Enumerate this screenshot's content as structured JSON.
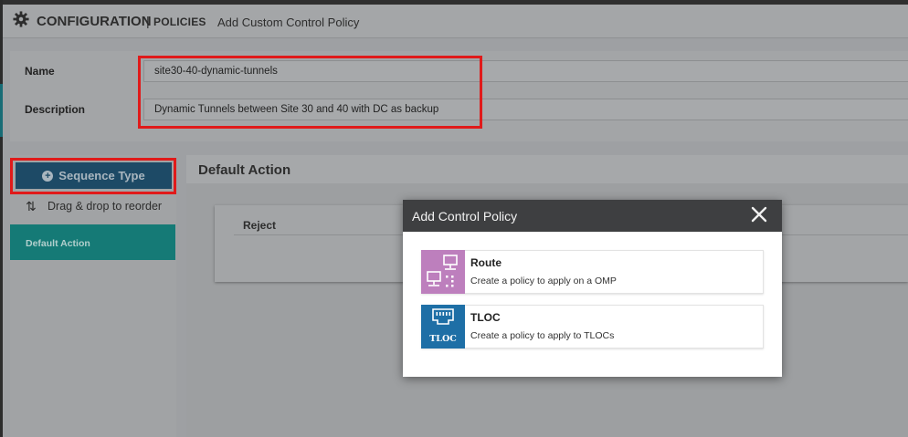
{
  "header": {
    "title": "CONFIGURATION",
    "separator": "|",
    "section": "POLICIES",
    "crumb": "Add Custom Control Policy",
    "icon": "gear-icon"
  },
  "form": {
    "name_label": "Name",
    "name_value": "site30-40-dynamic-tunnels",
    "description_label": "Description",
    "description_value": "Dynamic Tunnels between Site 30 and 40 with DC as backup"
  },
  "sidebar": {
    "sequence_button": "Sequence Type",
    "drag_hint": "Drag & drop to reorder",
    "items": [
      {
        "label": "Default Action",
        "active": true
      }
    ]
  },
  "main": {
    "title": "Default Action",
    "action_value": "Reject"
  },
  "modal": {
    "title": "Add Control Policy",
    "options": [
      {
        "title": "Route",
        "description": "Create a policy to apply on a OMP",
        "icon": "route-icon",
        "color": "#bd7fbd"
      },
      {
        "title": "TLOC",
        "description": "Create a policy to apply to TLOCs",
        "icon": "tloc-icon",
        "icon_text": "TLOC",
        "color": "#1e6fa6"
      }
    ]
  },
  "colors": {
    "highlight": "#e01a1a",
    "button": "#1d4a66",
    "active_item": "#157a76"
  }
}
